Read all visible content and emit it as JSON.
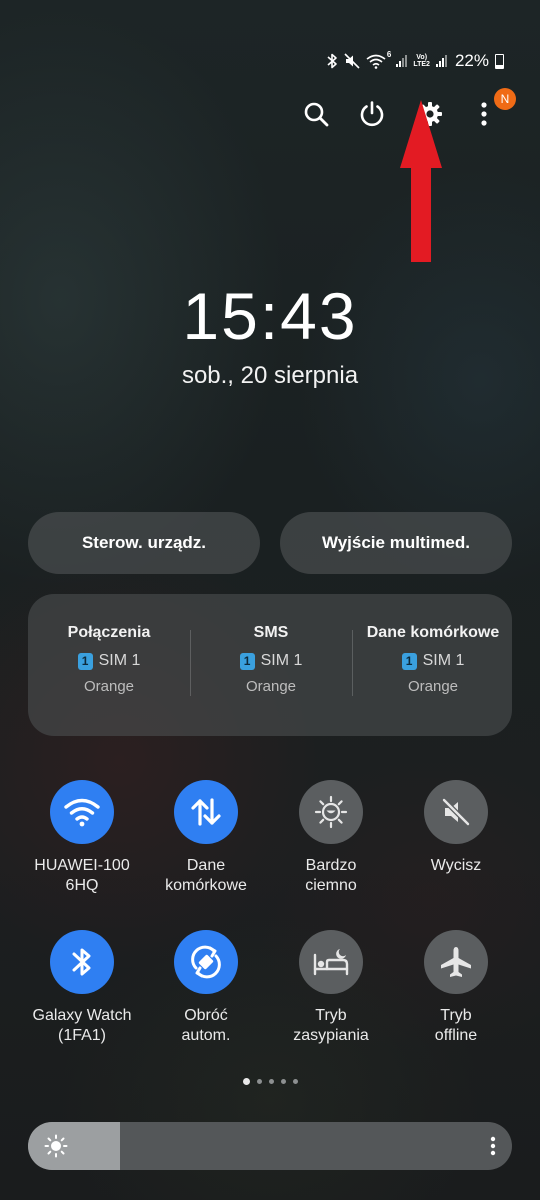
{
  "status_bar": {
    "icons": [
      "bluetooth-icon",
      "mute-icon",
      "wifi-6-icon",
      "signal-icon",
      "volte-icon",
      "signal-icon"
    ],
    "wifi_badge": "6",
    "volte_line1": "Vo)",
    "volte_line2": "LTE2",
    "battery_percent": "22%",
    "battery_level": 0.22
  },
  "header_icons": {
    "notification_badge": "N",
    "badge_color": "#f06b16"
  },
  "annotation": {
    "arrow_color": "#e31b23"
  },
  "clock": {
    "time": "15:43",
    "date": "sob., 20 sierpnia"
  },
  "quick_buttons": {
    "device_control": "Sterow. urządz.",
    "media_output": "Wyjście multimed."
  },
  "sim_panel": [
    {
      "title": "Połączenia",
      "sim_number": "1",
      "sim_label": "SIM 1",
      "operator": "Orange"
    },
    {
      "title": "SMS",
      "sim_number": "1",
      "sim_label": "SIM 1",
      "operator": "Orange"
    },
    {
      "title": "Dane komórkowe",
      "sim_number": "1",
      "sim_label": "SIM 1",
      "operator": "Orange"
    }
  ],
  "tiles": [
    {
      "label": "HUAWEI-100\n6HQ",
      "icon": "wifi-icon",
      "on": true
    },
    {
      "label": "Dane\nkomórkowe",
      "icon": "mobile-data-icon",
      "on": true
    },
    {
      "label": "Bardzo\nciemno",
      "icon": "extra-dim-icon",
      "on": false
    },
    {
      "label": "Wycisz",
      "icon": "mute-icon",
      "on": false
    },
    {
      "label": "Galaxy Watch\n(1FA1)",
      "icon": "bluetooth-icon",
      "on": true
    },
    {
      "label": "Obróć\nautom.",
      "icon": "auto-rotate-icon",
      "on": true
    },
    {
      "label": "Tryb\nzasypiania",
      "icon": "bed-icon",
      "on": false
    },
    {
      "label": "Tryb\noffline",
      "icon": "airplane-icon",
      "on": false
    }
  ],
  "pager": {
    "pages": 5,
    "current": 1
  },
  "brightness": {
    "level": 0.19
  },
  "colors": {
    "accent": "#2f7ff2",
    "tile_off": "#5b5e60"
  }
}
